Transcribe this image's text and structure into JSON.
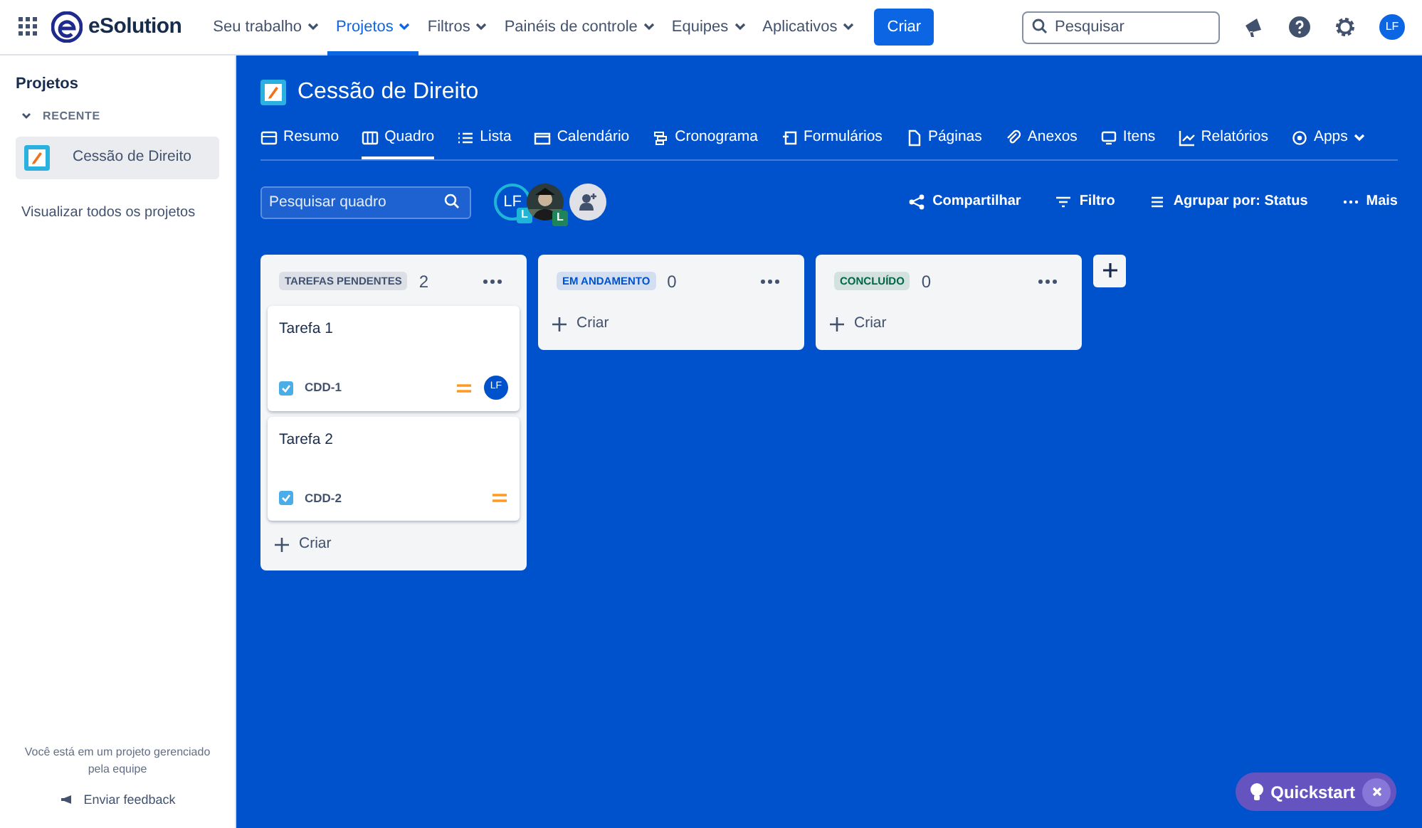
{
  "topnav": {
    "logo": "eSolution",
    "menus": [
      {
        "label": "Seu trabalho",
        "selected": false
      },
      {
        "label": "Projetos",
        "selected": true
      },
      {
        "label": "Filtros",
        "selected": false
      },
      {
        "label": "Painéis de controle",
        "selected": false
      },
      {
        "label": "Equipes",
        "selected": false
      },
      {
        "label": "Aplicativos",
        "selected": false
      }
    ],
    "create_button": "Criar",
    "search": {
      "placeholder": "Pesquisar"
    },
    "user_initials": "LF"
  },
  "sidebar": {
    "title": "Projetos",
    "section": {
      "label": "RECENTE",
      "expanded": true
    },
    "items": [
      {
        "label": "Cessão de Direito",
        "selected": true
      }
    ],
    "link": "Visualizar todos os projetos",
    "note": "Você está em um projeto gerenciado pela equipe",
    "feedback": "Enviar feedback"
  },
  "project": {
    "title": "Cessão de Direito",
    "tabs": [
      {
        "label": "Resumo",
        "selected": false
      },
      {
        "label": "Quadro",
        "selected": true
      },
      {
        "label": "Lista",
        "selected": false
      },
      {
        "label": "Calendário",
        "selected": false
      },
      {
        "label": "Cronograma",
        "selected": false
      },
      {
        "label": "Formulários",
        "selected": false
      },
      {
        "label": "Páginas",
        "selected": false
      },
      {
        "label": "Anexos",
        "selected": false
      },
      {
        "label": "Itens",
        "selected": false
      },
      {
        "label": "Relatórios",
        "selected": false
      },
      {
        "label": "Apps",
        "selected": false
      }
    ],
    "board_search": {
      "placeholder": "Pesquisar quadro"
    },
    "avatars": [
      {
        "kind": "initials",
        "initials": "LF",
        "badge": "L"
      },
      {
        "kind": "picture",
        "badge": "L"
      }
    ],
    "actions": [
      "Compartilhar",
      "Filtro",
      "Agrupar por: Status",
      "Mais"
    ]
  },
  "columns": [
    {
      "status": "TAREFAS PENDENTES",
      "color": "#42526e",
      "count": "2",
      "create": "Criar",
      "cards": [
        {
          "title": "Tarefa 1",
          "key": "CDD-1",
          "assignee": "LF"
        },
        {
          "title": "Tarefa 2",
          "key": "CDD-2"
        }
      ]
    },
    {
      "status": "EM ANDAMENTO",
      "color": "#0052cc",
      "count": "0",
      "create": "Criar"
    },
    {
      "status": "CONCLUÍDO",
      "color": "#006644",
      "count": "0",
      "create": "Criar"
    }
  ],
  "quickstart": {
    "label": "Quickstart"
  }
}
